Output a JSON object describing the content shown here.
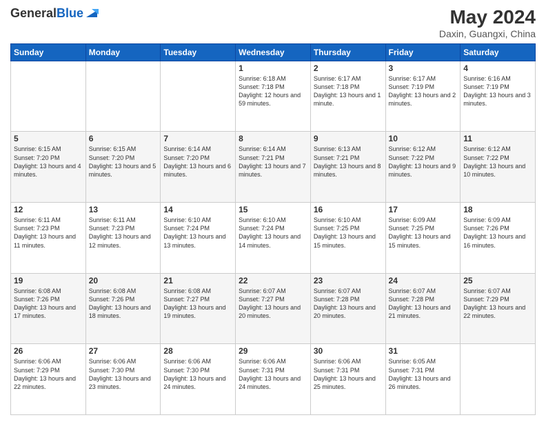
{
  "logo": {
    "general": "General",
    "blue": "Blue"
  },
  "header": {
    "month_year": "May 2024",
    "location": "Daxin, Guangxi, China"
  },
  "weekdays": [
    "Sunday",
    "Monday",
    "Tuesday",
    "Wednesday",
    "Thursday",
    "Friday",
    "Saturday"
  ],
  "weeks": [
    [
      {
        "day": "",
        "sunrise": "",
        "sunset": "",
        "daylight": ""
      },
      {
        "day": "",
        "sunrise": "",
        "sunset": "",
        "daylight": ""
      },
      {
        "day": "",
        "sunrise": "",
        "sunset": "",
        "daylight": ""
      },
      {
        "day": "1",
        "sunrise": "Sunrise: 6:18 AM",
        "sunset": "Sunset: 7:18 PM",
        "daylight": "Daylight: 12 hours and 59 minutes."
      },
      {
        "day": "2",
        "sunrise": "Sunrise: 6:17 AM",
        "sunset": "Sunset: 7:18 PM",
        "daylight": "Daylight: 13 hours and 1 minute."
      },
      {
        "day": "3",
        "sunrise": "Sunrise: 6:17 AM",
        "sunset": "Sunset: 7:19 PM",
        "daylight": "Daylight: 13 hours and 2 minutes."
      },
      {
        "day": "4",
        "sunrise": "Sunrise: 6:16 AM",
        "sunset": "Sunset: 7:19 PM",
        "daylight": "Daylight: 13 hours and 3 minutes."
      }
    ],
    [
      {
        "day": "5",
        "sunrise": "Sunrise: 6:15 AM",
        "sunset": "Sunset: 7:20 PM",
        "daylight": "Daylight: 13 hours and 4 minutes."
      },
      {
        "day": "6",
        "sunrise": "Sunrise: 6:15 AM",
        "sunset": "Sunset: 7:20 PM",
        "daylight": "Daylight: 13 hours and 5 minutes."
      },
      {
        "day": "7",
        "sunrise": "Sunrise: 6:14 AM",
        "sunset": "Sunset: 7:20 PM",
        "daylight": "Daylight: 13 hours and 6 minutes."
      },
      {
        "day": "8",
        "sunrise": "Sunrise: 6:14 AM",
        "sunset": "Sunset: 7:21 PM",
        "daylight": "Daylight: 13 hours and 7 minutes."
      },
      {
        "day": "9",
        "sunrise": "Sunrise: 6:13 AM",
        "sunset": "Sunset: 7:21 PM",
        "daylight": "Daylight: 13 hours and 8 minutes."
      },
      {
        "day": "10",
        "sunrise": "Sunrise: 6:12 AM",
        "sunset": "Sunset: 7:22 PM",
        "daylight": "Daylight: 13 hours and 9 minutes."
      },
      {
        "day": "11",
        "sunrise": "Sunrise: 6:12 AM",
        "sunset": "Sunset: 7:22 PM",
        "daylight": "Daylight: 13 hours and 10 minutes."
      }
    ],
    [
      {
        "day": "12",
        "sunrise": "Sunrise: 6:11 AM",
        "sunset": "Sunset: 7:23 PM",
        "daylight": "Daylight: 13 hours and 11 minutes."
      },
      {
        "day": "13",
        "sunrise": "Sunrise: 6:11 AM",
        "sunset": "Sunset: 7:23 PM",
        "daylight": "Daylight: 13 hours and 12 minutes."
      },
      {
        "day": "14",
        "sunrise": "Sunrise: 6:10 AM",
        "sunset": "Sunset: 7:24 PM",
        "daylight": "Daylight: 13 hours and 13 minutes."
      },
      {
        "day": "15",
        "sunrise": "Sunrise: 6:10 AM",
        "sunset": "Sunset: 7:24 PM",
        "daylight": "Daylight: 13 hours and 14 minutes."
      },
      {
        "day": "16",
        "sunrise": "Sunrise: 6:10 AM",
        "sunset": "Sunset: 7:25 PM",
        "daylight": "Daylight: 13 hours and 15 minutes."
      },
      {
        "day": "17",
        "sunrise": "Sunrise: 6:09 AM",
        "sunset": "Sunset: 7:25 PM",
        "daylight": "Daylight: 13 hours and 15 minutes."
      },
      {
        "day": "18",
        "sunrise": "Sunrise: 6:09 AM",
        "sunset": "Sunset: 7:26 PM",
        "daylight": "Daylight: 13 hours and 16 minutes."
      }
    ],
    [
      {
        "day": "19",
        "sunrise": "Sunrise: 6:08 AM",
        "sunset": "Sunset: 7:26 PM",
        "daylight": "Daylight: 13 hours and 17 minutes."
      },
      {
        "day": "20",
        "sunrise": "Sunrise: 6:08 AM",
        "sunset": "Sunset: 7:26 PM",
        "daylight": "Daylight: 13 hours and 18 minutes."
      },
      {
        "day": "21",
        "sunrise": "Sunrise: 6:08 AM",
        "sunset": "Sunset: 7:27 PM",
        "daylight": "Daylight: 13 hours and 19 minutes."
      },
      {
        "day": "22",
        "sunrise": "Sunrise: 6:07 AM",
        "sunset": "Sunset: 7:27 PM",
        "daylight": "Daylight: 13 hours and 20 minutes."
      },
      {
        "day": "23",
        "sunrise": "Sunrise: 6:07 AM",
        "sunset": "Sunset: 7:28 PM",
        "daylight": "Daylight: 13 hours and 20 minutes."
      },
      {
        "day": "24",
        "sunrise": "Sunrise: 6:07 AM",
        "sunset": "Sunset: 7:28 PM",
        "daylight": "Daylight: 13 hours and 21 minutes."
      },
      {
        "day": "25",
        "sunrise": "Sunrise: 6:07 AM",
        "sunset": "Sunset: 7:29 PM",
        "daylight": "Daylight: 13 hours and 22 minutes."
      }
    ],
    [
      {
        "day": "26",
        "sunrise": "Sunrise: 6:06 AM",
        "sunset": "Sunset: 7:29 PM",
        "daylight": "Daylight: 13 hours and 22 minutes."
      },
      {
        "day": "27",
        "sunrise": "Sunrise: 6:06 AM",
        "sunset": "Sunset: 7:30 PM",
        "daylight": "Daylight: 13 hours and 23 minutes."
      },
      {
        "day": "28",
        "sunrise": "Sunrise: 6:06 AM",
        "sunset": "Sunset: 7:30 PM",
        "daylight": "Daylight: 13 hours and 24 minutes."
      },
      {
        "day": "29",
        "sunrise": "Sunrise: 6:06 AM",
        "sunset": "Sunset: 7:31 PM",
        "daylight": "Daylight: 13 hours and 24 minutes."
      },
      {
        "day": "30",
        "sunrise": "Sunrise: 6:06 AM",
        "sunset": "Sunset: 7:31 PM",
        "daylight": "Daylight: 13 hours and 25 minutes."
      },
      {
        "day": "31",
        "sunrise": "Sunrise: 6:05 AM",
        "sunset": "Sunset: 7:31 PM",
        "daylight": "Daylight: 13 hours and 26 minutes."
      },
      {
        "day": "",
        "sunrise": "",
        "sunset": "",
        "daylight": ""
      }
    ]
  ]
}
